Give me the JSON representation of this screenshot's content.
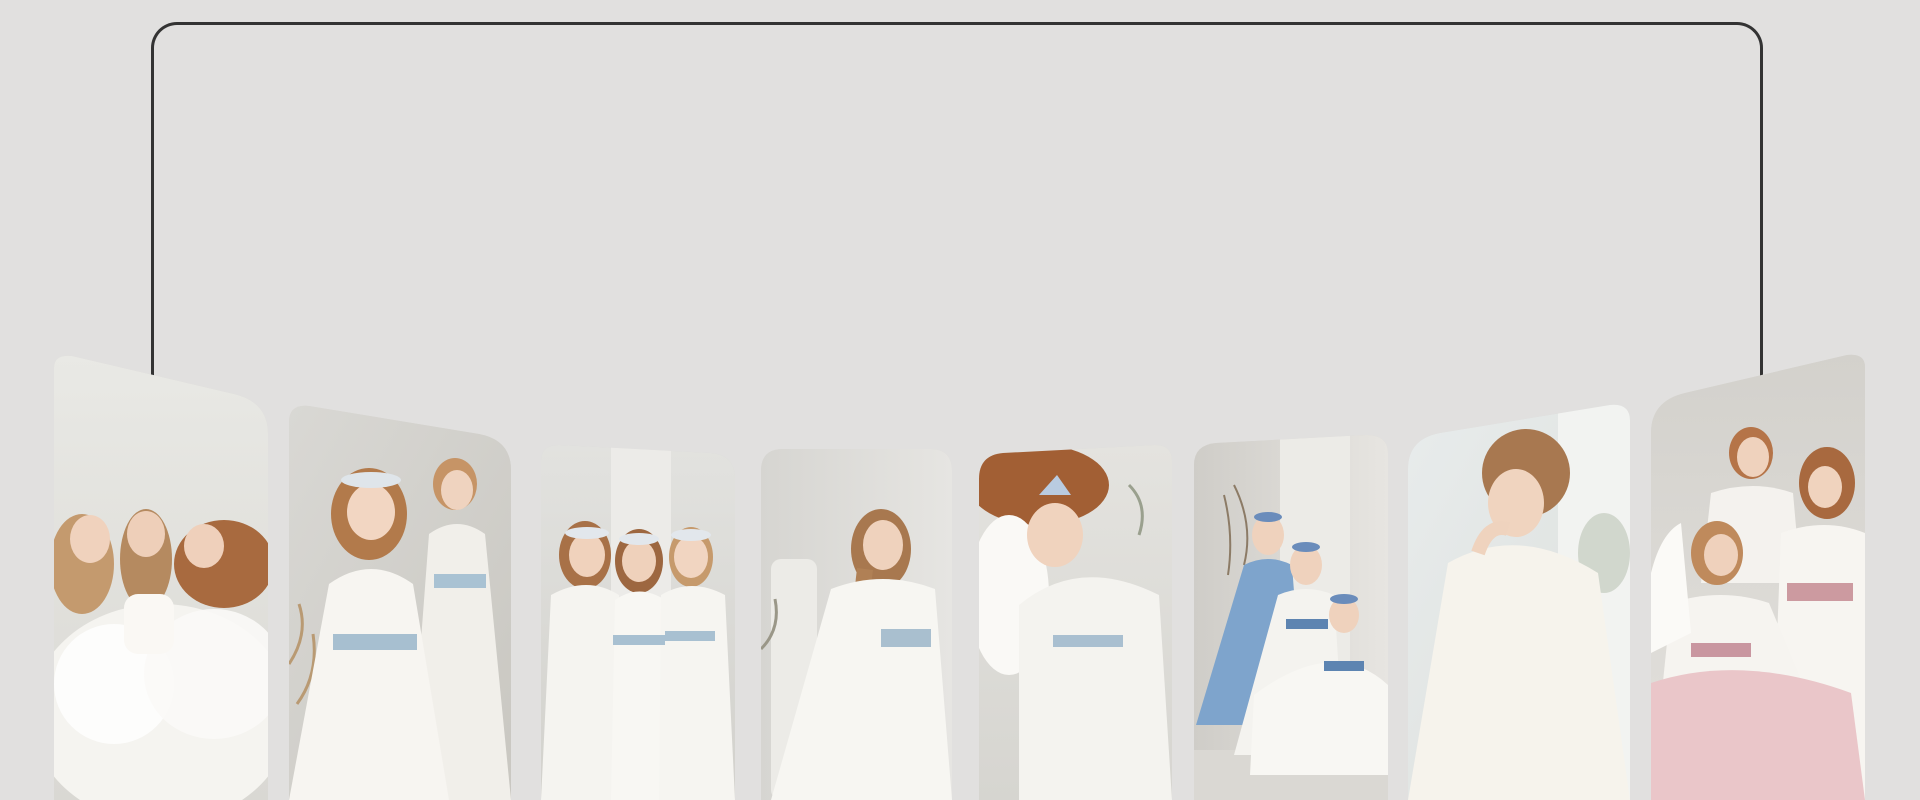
{
  "palette": {
    "background": "#e1e0df",
    "outline": "#333333",
    "dress_white": "#f4f2ee",
    "sash_blue": "#9fb9cc",
    "sash_pink": "#cf9c9f",
    "dress_blue": "#7fa7cf",
    "dress_pink": "#ebc8cb",
    "hair_blonde": "#c89a6a",
    "hair_auburn": "#a4643e"
  },
  "gallery": {
    "cards": [
      {
        "id": "card-1",
        "scene": "three-girls-lying-in-tulle",
        "sash": "none"
      },
      {
        "id": "card-2",
        "scene": "two-girls-standing-blue-sashes",
        "sash": "blue"
      },
      {
        "id": "card-3",
        "scene": "three-girls-holding-hands",
        "sash": "blue"
      },
      {
        "id": "card-4",
        "scene": "girl-standing-long-hair",
        "sash": "blue"
      },
      {
        "id": "card-5",
        "scene": "girl-reclining-curly-hair",
        "sash": "blue"
      },
      {
        "id": "card-6",
        "scene": "three-girls-blue-dresses-seated",
        "sash": "blue"
      },
      {
        "id": "card-7",
        "scene": "girl-seated-thinking-pose",
        "sash": "none"
      },
      {
        "id": "card-8",
        "scene": "three-girls-pink-sashes",
        "sash": "pink"
      }
    ]
  }
}
